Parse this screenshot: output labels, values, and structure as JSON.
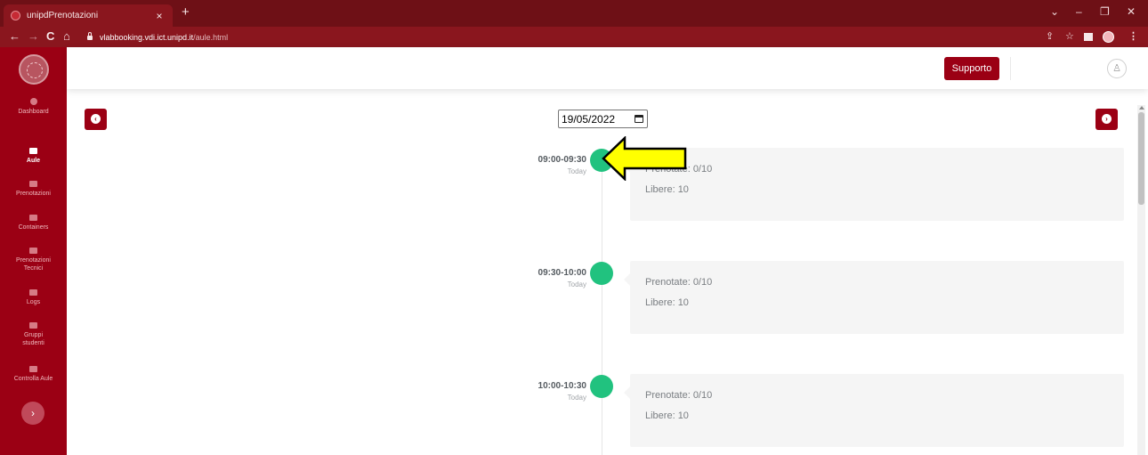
{
  "browser": {
    "tab_title": "unipdPrenotazioni",
    "tab_close": "×",
    "new_tab": "+",
    "url_host": "vlabbooking.vdi.ict.unipd.it",
    "url_path": "/aule.html",
    "nav_back": "←",
    "nav_forward": "→",
    "nav_reload": "C",
    "nav_home": "⌂",
    "win_minimize_menu": "⌄",
    "win_minimize": "–",
    "win_restore": "❐",
    "win_close": "✕",
    "share": "⇪",
    "star": "☆",
    "menu": "⋮"
  },
  "sidebar": {
    "items": [
      {
        "label": "Dashboard",
        "active": false
      },
      {
        "label": "Aule",
        "active": true
      },
      {
        "label": "Prenotazioni",
        "active": false
      },
      {
        "label": "Containers",
        "active": false
      },
      {
        "label": "Prenotazioni Tecnici",
        "active": false
      },
      {
        "label": "Logs",
        "active": false
      },
      {
        "label": "Gruppi studenti",
        "active": false
      },
      {
        "label": "Controlla Aule",
        "active": false
      }
    ],
    "expand": "›"
  },
  "header": {
    "support_label": "Supporto",
    "user_icon": "♙"
  },
  "main": {
    "date_value": "19/05/2022",
    "prev_arrow": "‹",
    "next_arrow": "›",
    "slots": [
      {
        "time": "09:00-09:30",
        "day": "Today",
        "booked": "Prenotate: 0/10",
        "free": "Libere: 10"
      },
      {
        "time": "09:30-10:00",
        "day": "Today",
        "booked": "Prenotate: 0/10",
        "free": "Libere: 10"
      },
      {
        "time": "10:00-10:30",
        "day": "Today",
        "booked": "Prenotate: 0/10",
        "free": "Libere: 10"
      }
    ]
  },
  "colors": {
    "brand": "#9b0014",
    "slot_dot": "#21c27f",
    "annotation_arrow": "#ffff00"
  },
  "icons": [
    "lock-icon",
    "calendar-icon",
    "user-icon",
    "arrow-left-circle-icon",
    "arrow-right-circle-icon",
    "annotation-arrow-icon"
  ]
}
